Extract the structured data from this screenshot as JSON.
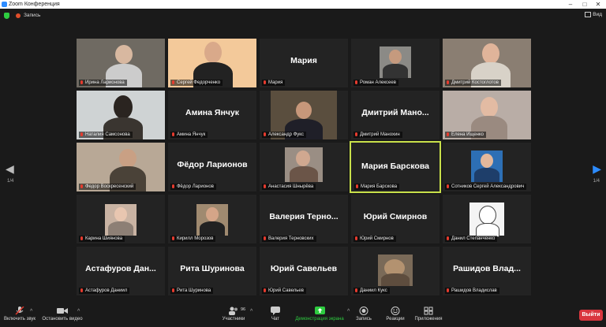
{
  "window": {
    "title": "Zoom Конференция"
  },
  "topbar": {
    "recording": "Запись",
    "view": "Вид"
  },
  "pagination": {
    "left": "1/4",
    "right": "1/4"
  },
  "participants": [
    {
      "label": "Ирина Ларионова",
      "big": ""
    },
    {
      "label": "Сергей Федорченко",
      "big": ""
    },
    {
      "label": "Мария",
      "big": "Мария"
    },
    {
      "label": "Роман Алексеев",
      "big": ""
    },
    {
      "label": "Дмитрий Костоглотов",
      "big": ""
    },
    {
      "label": "Наталия Самсонова",
      "big": ""
    },
    {
      "label": "Амина Янчук",
      "big": "Амина Янчук"
    },
    {
      "label": "Александр Фукс",
      "big": ""
    },
    {
      "label": "Дмитрий Манохин",
      "big": "Дмитрий Мано..."
    },
    {
      "label": "Елена Ищенко",
      "big": ""
    },
    {
      "label": "Федор Воскресенский",
      "big": ""
    },
    {
      "label": "Фёдор Ларионов",
      "big": "Фёдор Ларионов"
    },
    {
      "label": "Анастасия Шнырёва",
      "big": ""
    },
    {
      "label": "Мария Барскова",
      "big": "Мария Барскова"
    },
    {
      "label": "Сотников Сергей Александрович",
      "big": ""
    },
    {
      "label": "Карина Шиянова",
      "big": ""
    },
    {
      "label": "Кирилл Морозов",
      "big": ""
    },
    {
      "label": "Валерия Терновских",
      "big": "Валерия Терно..."
    },
    {
      "label": "Юрий Смирнов",
      "big": "Юрий Смирнов"
    },
    {
      "label": "Данил Степанченко",
      "big": ""
    },
    {
      "label": "Астафуров Даниил",
      "big": "Астафуров Дан..."
    },
    {
      "label": "Рита Шуринова",
      "big": "Рита Шуринова"
    },
    {
      "label": "Юрий Савельев",
      "big": "Юрий Савельев"
    },
    {
      "label": "Даниил Кукс",
      "big": ""
    },
    {
      "label": "Рашидов Владислав",
      "big": "Рашидов Влад..."
    }
  ],
  "toolbar": {
    "unmute": "Включить звук",
    "start_video": "Остановить видео",
    "participants": "Участники",
    "participants_count": "96",
    "chat": "Чат",
    "share": "Демонстрация экрана",
    "record": "Запись",
    "reactions": "Реакции",
    "apps": "Приложения",
    "leave": "Выйти"
  },
  "colors": {
    "active_speaker": "#c8e04a",
    "share_green": "#2ecc40",
    "leave_red": "#d9363e",
    "muted_red": "#e63b2e"
  }
}
